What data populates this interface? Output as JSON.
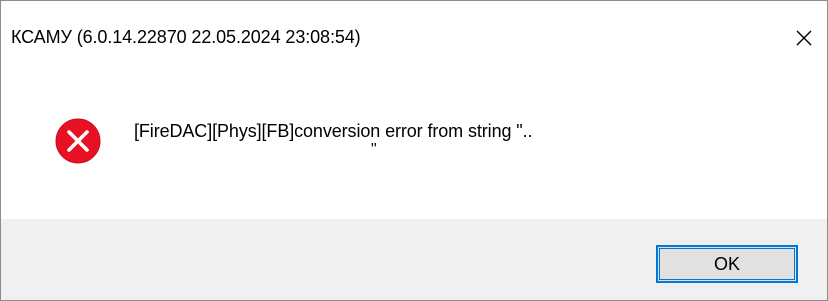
{
  "window": {
    "title": "КСАМУ (6.0.14.22870 22.05.2024 23:08:54)",
    "close_icon": "close-icon"
  },
  "dialog": {
    "icon": "error-icon",
    "icon_color": "#e81123",
    "message": "[FireDAC][Phys][FB]conversion error from string \"..",
    "message_continuation": "\""
  },
  "buttons": {
    "ok_label": "OK"
  },
  "colors": {
    "accent": "#0078d7",
    "footer_bg": "#f0f0f0",
    "button_bg": "#e1e1e1"
  }
}
